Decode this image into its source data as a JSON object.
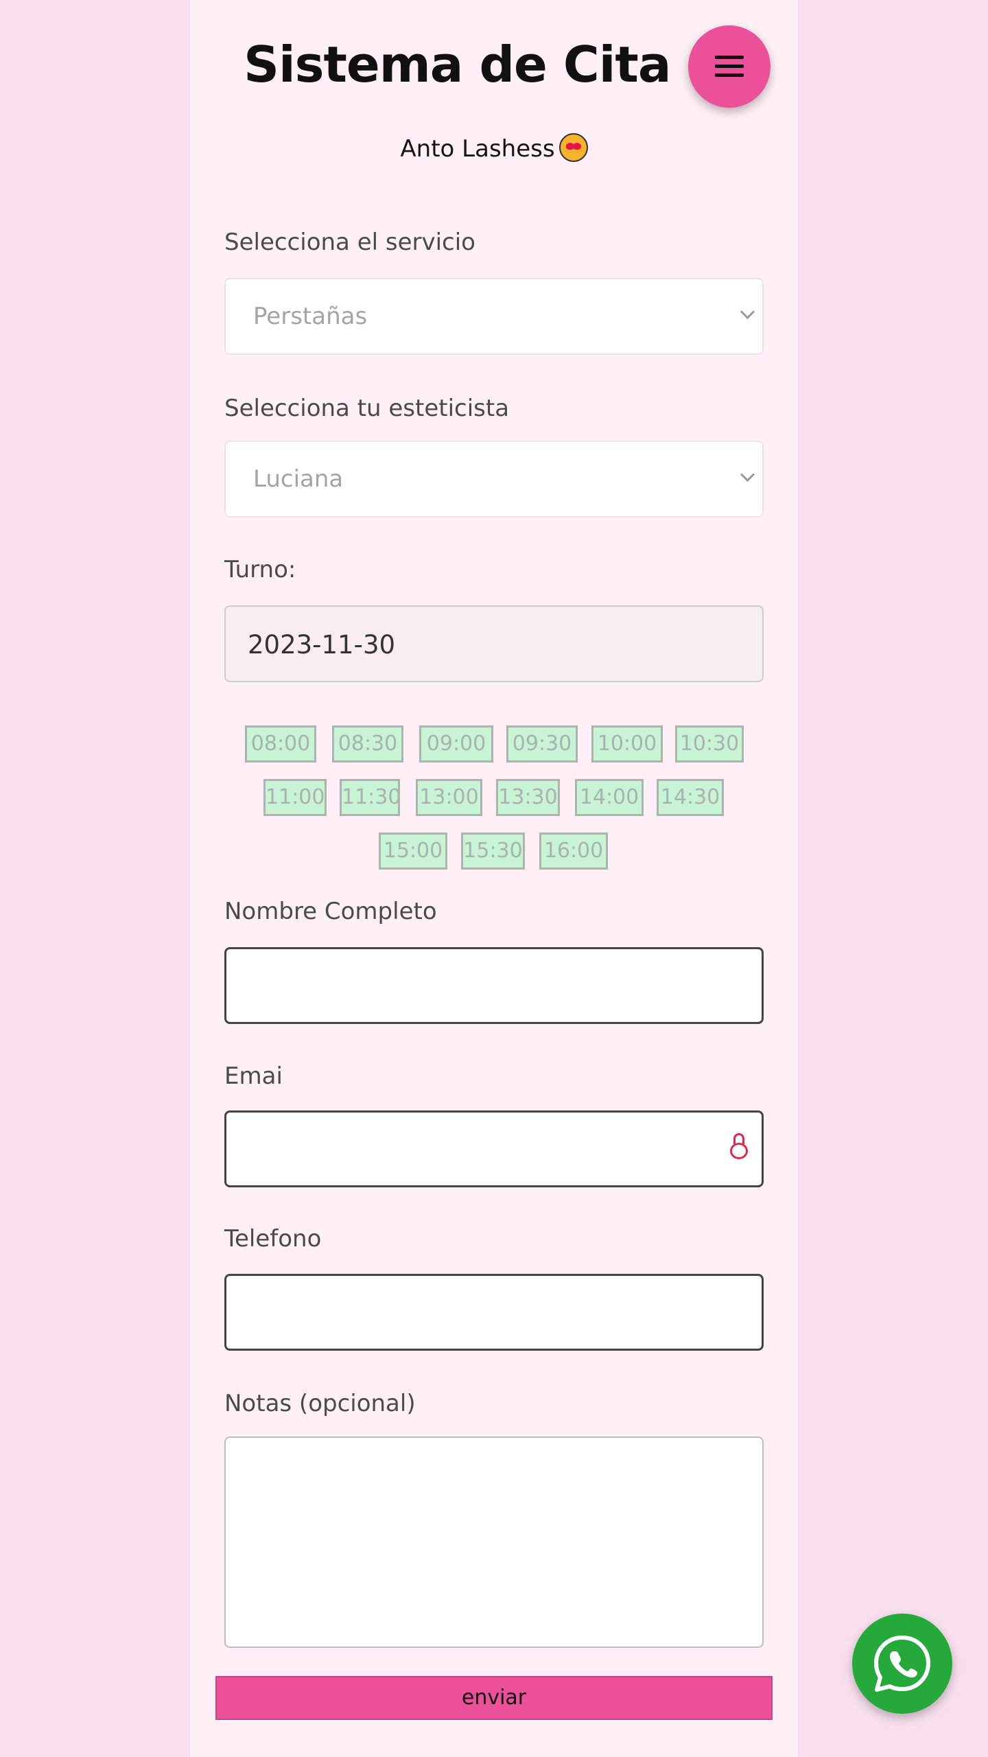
{
  "header": {
    "title": "Sistema de Cita :::",
    "subtitle": "Anto Lashess",
    "subtitle_icon": "smiling-face-with-heart-eyes-icon",
    "menu_icon": "hamburger-icon"
  },
  "form": {
    "service": {
      "label": "Selecciona el servicio",
      "value": "Perstañas"
    },
    "esthetician": {
      "label": "Selecciona tu esteticista",
      "value": "Luciana"
    },
    "turno": {
      "label": "Turno:",
      "value": "2023-11-30"
    },
    "time_slots": [
      "08:00",
      "08:30",
      "09:00",
      "09:30",
      "10:00",
      "10:30",
      "11:00",
      "11:30",
      "13:00",
      "13:30",
      "14:00",
      "14:30",
      "15:00",
      "15:30",
      "16:00"
    ],
    "full_name": {
      "label": "Nombre Completo",
      "value": ""
    },
    "email": {
      "label": "Emai",
      "value": ""
    },
    "phone": {
      "label": "Telefono",
      "value": ""
    },
    "notes": {
      "label": "Notas (opcional)",
      "value": ""
    },
    "submit_label": "enviar"
  },
  "colors": {
    "accent": "#ea5198",
    "page_bg": "#f9dfee",
    "panel_bg": "#fff0f7",
    "slot_bg": "#c9f3d7",
    "whatsapp": "#25a93a"
  },
  "floating": {
    "whatsapp_icon": "whatsapp-icon"
  }
}
